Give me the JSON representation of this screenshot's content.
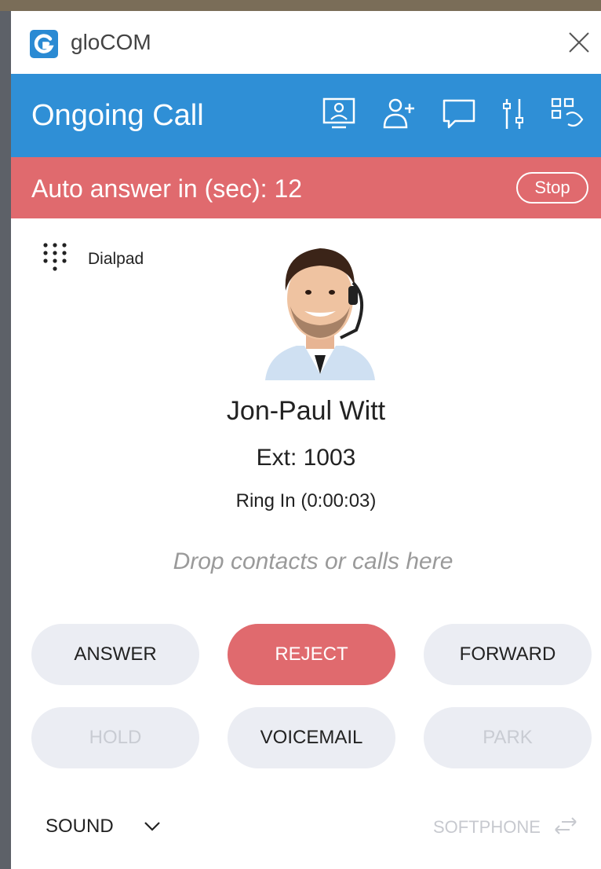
{
  "app": {
    "name": "gloCOM"
  },
  "header": {
    "title": "Ongoing Call",
    "icons": [
      "screen-share-icon",
      "add-contact-icon",
      "chat-icon",
      "settings-sliders-icon",
      "layout-grid-icon"
    ]
  },
  "banner": {
    "text": "Auto answer in (sec): 12",
    "stop_label": "Stop",
    "color": "#e06a6e"
  },
  "dialpad": {
    "label": "Dialpad"
  },
  "caller": {
    "name": "Jon-Paul Witt",
    "ext": "Ext: 1003",
    "status": "Ring In (0:00:03)"
  },
  "drop_hint": "Drop contacts or calls here",
  "buttons": {
    "answer": "ANSWER",
    "reject": "REJECT",
    "forward": "FORWARD",
    "hold": "HOLD",
    "voicemail": "VOICEMAIL",
    "park": "PARK"
  },
  "footer": {
    "sound_label": "SOUND",
    "softphone_label": "SOFTPHONE"
  },
  "colors": {
    "accent": "#2f8fd6",
    "danger": "#e06a6e",
    "button_bg": "#ebedf3"
  }
}
